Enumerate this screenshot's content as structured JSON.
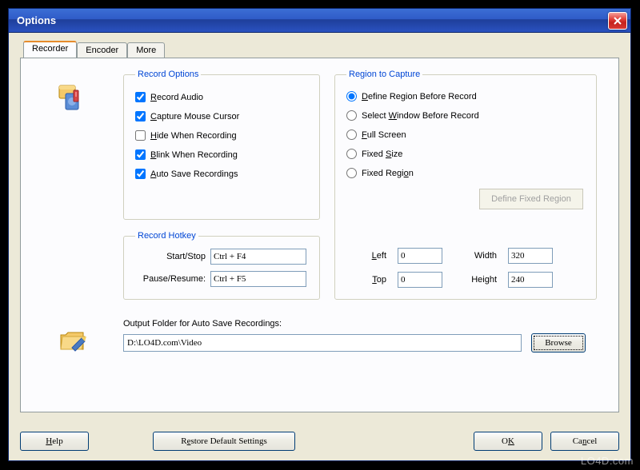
{
  "window": {
    "title": "Options"
  },
  "tabs": {
    "recorder": "Recorder",
    "encoder": "Encoder",
    "more": "More"
  },
  "record_opts": {
    "legend": "Record Options",
    "audio": "Record Audio",
    "cursor": "Capture Mouse Cursor",
    "hide": "Hide When Recording",
    "blink": "Blink When Recording",
    "autosave": "Auto Save Recordings",
    "audio_checked": true,
    "cursor_checked": true,
    "hide_checked": false,
    "blink_checked": true,
    "autosave_checked": true
  },
  "hotkey": {
    "legend": "Record Hotkey",
    "startstop_label": "Start/Stop",
    "pauseresume_label": "Pause/Resume:",
    "startstop": "Ctrl + F4",
    "pauseresume": "Ctrl + F5"
  },
  "region": {
    "legend": "Region to Capture",
    "define_before": "Define Region Before Record",
    "select_window": "Select Window Before Record",
    "full_screen": "Full Screen",
    "fixed_size": "Fixed Size",
    "fixed_region": "Fixed Region",
    "define_fixed_btn": "Define Fixed Region",
    "left_label": "Left",
    "top_label": "Top",
    "width_label": "Width",
    "height_label": "Height",
    "left": "0",
    "top": "0",
    "width": "320",
    "height": "240"
  },
  "output": {
    "label": "Output Folder for Auto Save Recordings:",
    "path": "D:\\LO4D.com\\Video",
    "browse": "Browse"
  },
  "buttons": {
    "help": "Help",
    "restore": "Restore Default Settings",
    "ok": "OK",
    "cancel": "Cancel"
  },
  "watermark": "LO4D.com"
}
